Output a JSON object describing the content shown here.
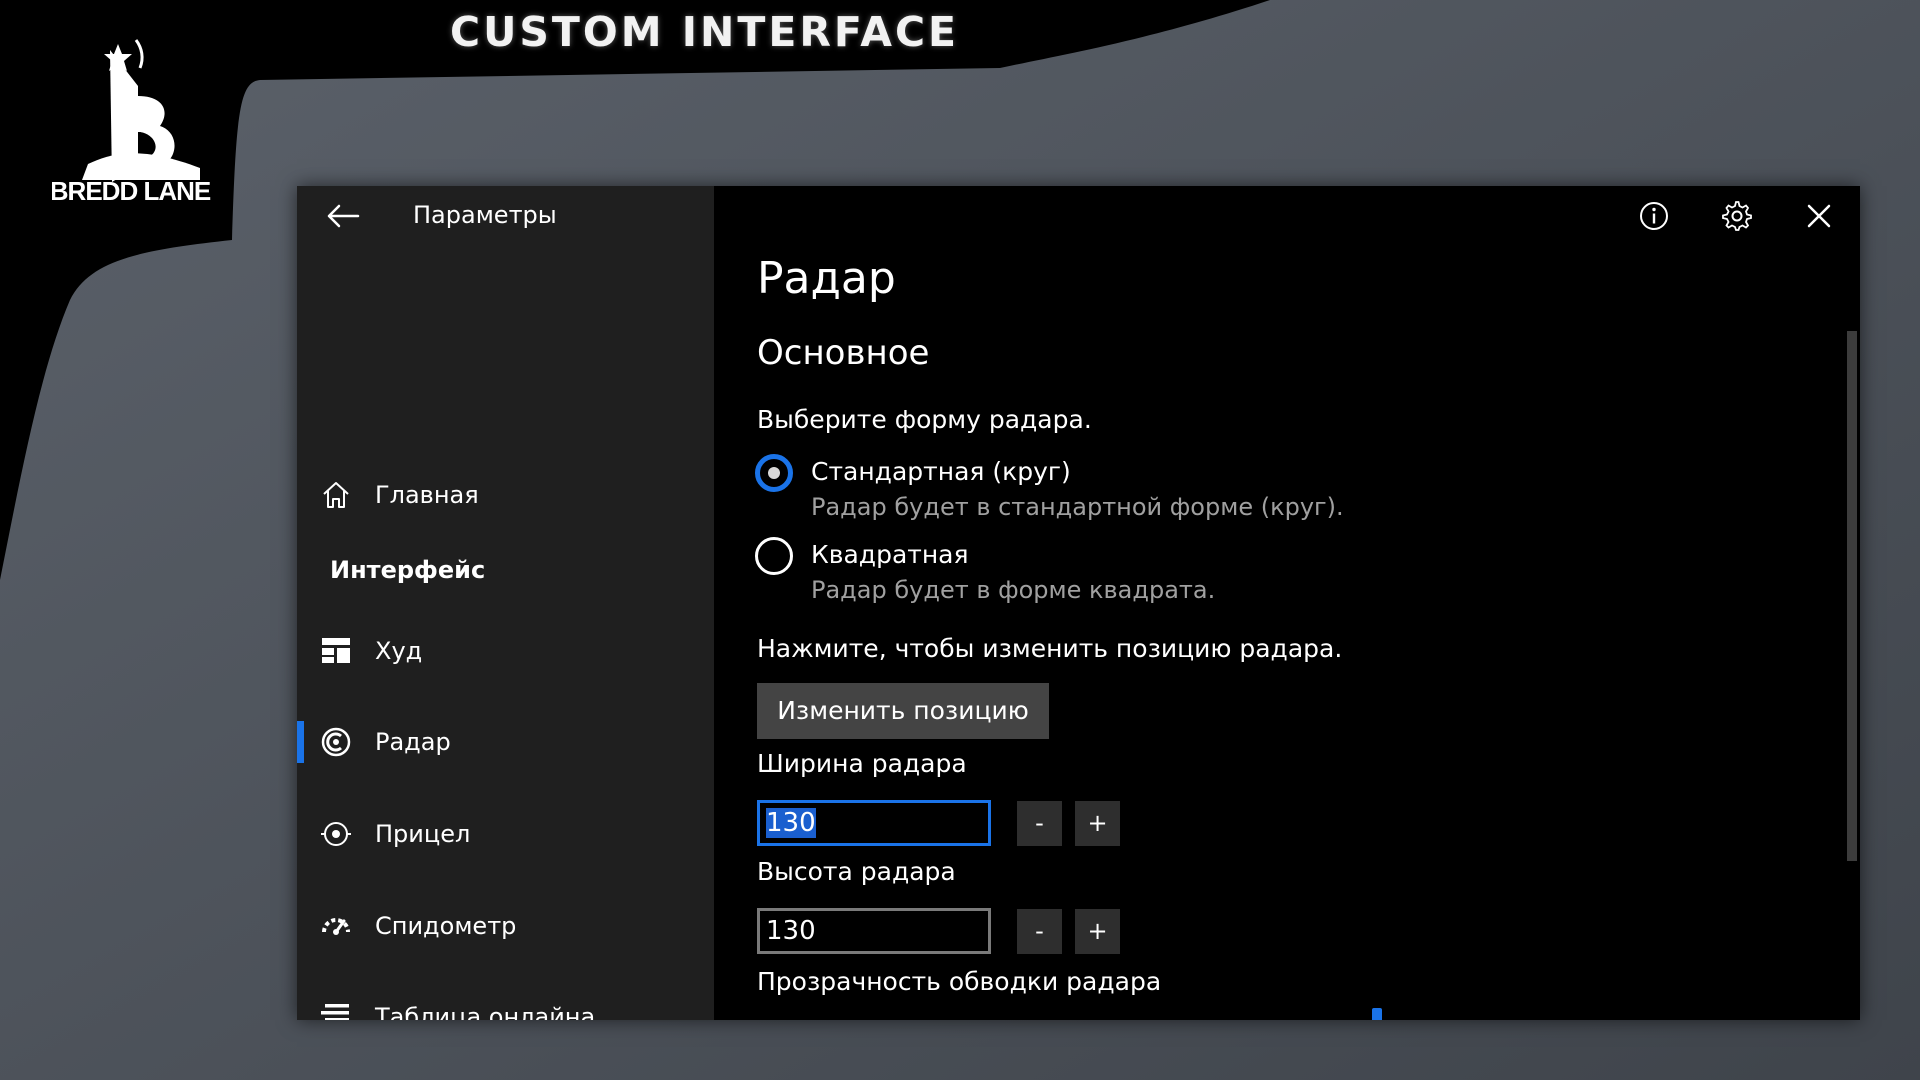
{
  "brand": {
    "logo_text": "BREDD LANE",
    "title": "CUSTOM INTERFACE"
  },
  "window": {
    "accent": "#1a73e8"
  },
  "sidebar": {
    "title": "Параметры",
    "home": {
      "label": "Главная",
      "icon": "home-icon"
    },
    "section_label": "Интерфейс",
    "items": [
      {
        "label": "Худ",
        "icon": "dashboard-icon"
      },
      {
        "label": "Радар",
        "icon": "radar-icon",
        "active": true
      },
      {
        "label": "Прицел",
        "icon": "crosshair-icon"
      },
      {
        "label": "Спидометр",
        "icon": "speedometer-icon"
      },
      {
        "label": "Таблица онлайна",
        "icon": "list-icon"
      }
    ]
  },
  "topbar": {
    "icons": [
      "info-icon",
      "gear-icon",
      "close-icon"
    ]
  },
  "content": {
    "title": "Радар",
    "subtitle": "Основное",
    "shape_prompt": "Выберите форму радара.",
    "shape_options": [
      {
        "label": "Стандартная (круг)",
        "description": "Радар будет в стандартной форме (круг).",
        "selected": true
      },
      {
        "label": "Квадратная",
        "description": "Радар будет в форме квадрата.",
        "selected": false
      }
    ],
    "position_prompt": "Нажмите, чтобы изменить позицию радара.",
    "position_button": "Изменить позицию",
    "width": {
      "label": "Ширина радара",
      "value": "130",
      "minus": "-",
      "plus": "+"
    },
    "height": {
      "label": "Высота радара",
      "value": "130",
      "minus": "-",
      "plus": "+"
    },
    "opacity_label": "Прозрачность обводки радара"
  }
}
